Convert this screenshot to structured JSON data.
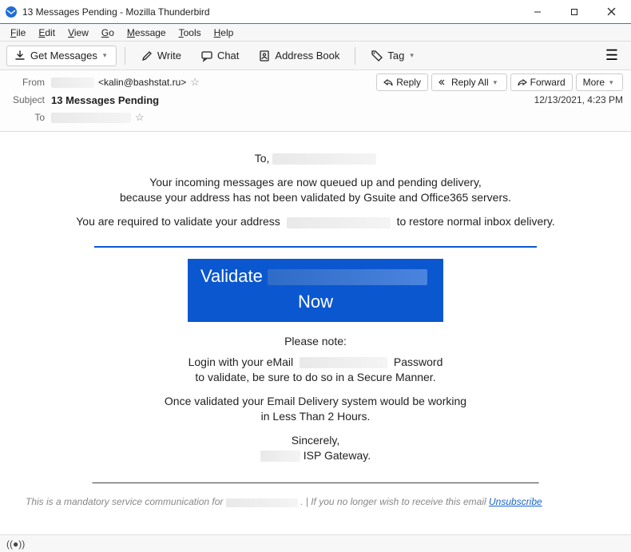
{
  "window": {
    "title": "13 Messages Pending - Mozilla Thunderbird"
  },
  "menu": {
    "file": "File",
    "edit": "Edit",
    "view": "View",
    "go": "Go",
    "message": "Message",
    "tools": "Tools",
    "help": "Help"
  },
  "toolbar": {
    "get_messages": "Get Messages",
    "write": "Write",
    "chat": "Chat",
    "address_book": "Address Book",
    "tag": "Tag"
  },
  "header": {
    "from_label": "From",
    "from_value": "<kalin@bashstat.ru>",
    "subject_label": "Subject",
    "subject_value": "13 Messages Pending",
    "to_label": "To",
    "date": "12/13/2021, 4:23 PM",
    "actions": {
      "reply": "Reply",
      "reply_all": "Reply All",
      "forward": "Forward",
      "more": "More"
    }
  },
  "body": {
    "to_prefix": "To,",
    "l1": "Your incoming messages are now queued up and pending delivery,",
    "l2": "because your address has not been validated by Gsuite and Office365 servers.",
    "l3a": "You are required to validate your address",
    "l3b": "to restore normal inbox delivery.",
    "validate_top": "Validate",
    "validate_bot": "Now",
    "note": "Please note:",
    "p1a": "Login with your eMail",
    "p1b": "Password",
    "p2": "to validate, be sure to do so in a Secure Manner.",
    "p3": "Once validated your Email Delivery system would be working",
    "p4": "in Less Than 2 Hours.",
    "sign1": "Sincerely,",
    "sign2": " ISP Gateway.",
    "dashes": "———————————————————————————————————————————",
    "footer_a": "This is a mandatory service communication for ",
    "footer_b": " .   |  If you no longer wish to receive this email ",
    "unsubscribe": "Unsubscribe"
  }
}
